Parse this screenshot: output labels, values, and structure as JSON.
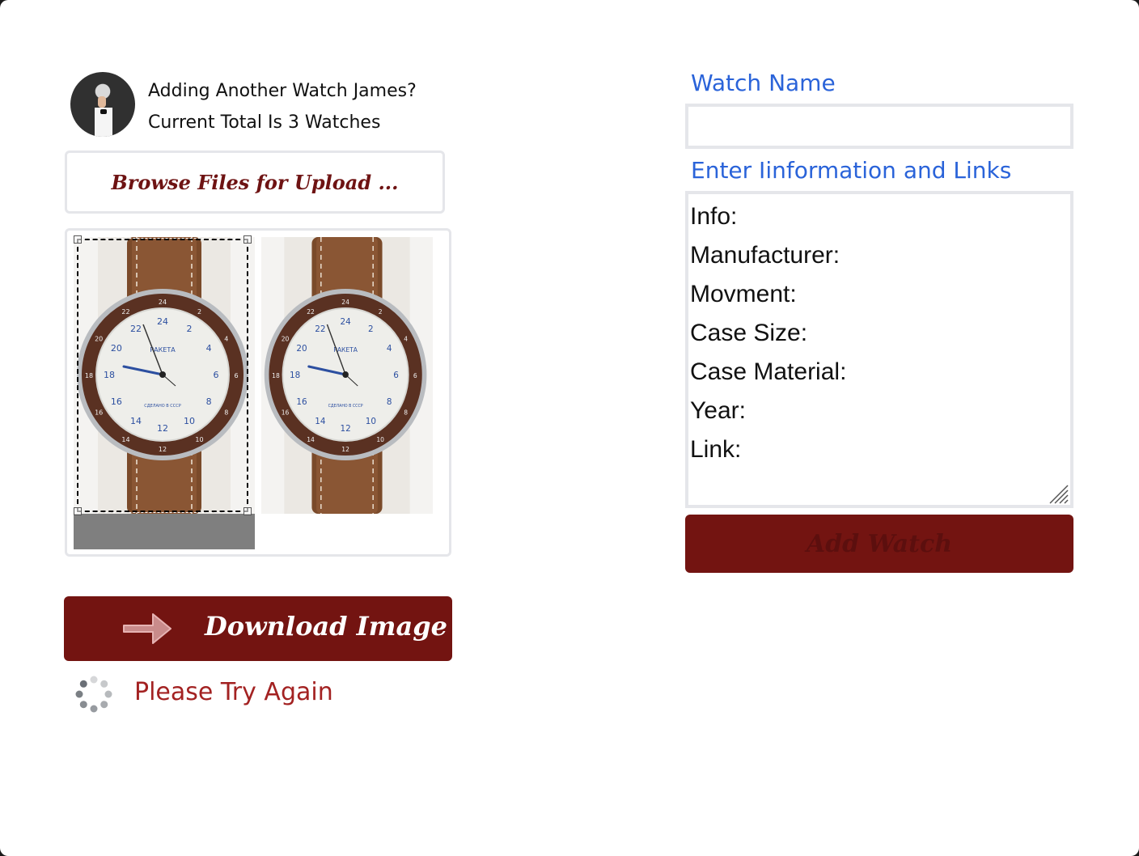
{
  "header": {
    "greeting_line1": "Adding Another Watch James?",
    "greeting_line2": "Current Total Is 3 Watches"
  },
  "upload": {
    "browse_label": "Browse Files for Upload ..."
  },
  "actions": {
    "download_label": "Download Image",
    "add_label": "Add Watch"
  },
  "status": {
    "message": "Please Try Again"
  },
  "form": {
    "watch_name_label": "Watch Name",
    "watch_name_value": "",
    "info_label": "Enter Iinformation and Links",
    "info_value": "Info:\nManufacturer:\nMovment:\nCase Size:\nCase Material:\nYear:\nLink:"
  },
  "watch_dial": {
    "brand": "РАКЕТА",
    "subtitle": "СДЕЛАНО В СССР",
    "numerals": [
      "24",
      "2",
      "4",
      "6",
      "8",
      "10",
      "12",
      "14",
      "16",
      "18",
      "20",
      "22"
    ]
  },
  "colors": {
    "button_bg": "#731411",
    "label_blue": "#2a63d9",
    "status_red": "#a32222",
    "browse_text": "#6e1313"
  }
}
